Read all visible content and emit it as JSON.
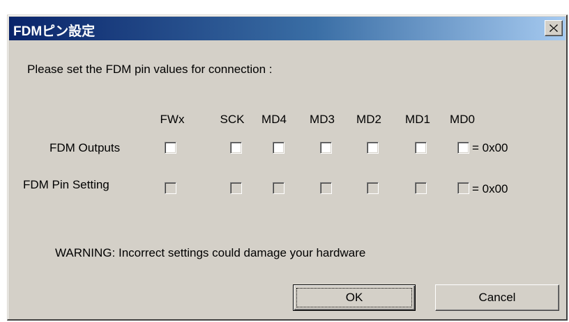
{
  "window": {
    "title": "FDMピン設定",
    "close_label": "close"
  },
  "prompt": "Please set the FDM pin values for connection :",
  "columns": [
    "FWx",
    "SCK",
    "MD4",
    "MD3",
    "MD2",
    "MD1",
    "MD0"
  ],
  "rows": {
    "outputs": {
      "label": "FDM Outputs",
      "checked": [
        false,
        false,
        false,
        false,
        false,
        false,
        false
      ],
      "enabled": true,
      "value": "= 0x00"
    },
    "pin_setting": {
      "label": "FDM Pin Setting",
      "checked": [
        false,
        false,
        false,
        false,
        false,
        false,
        false
      ],
      "enabled": false,
      "value": "= 0x00"
    }
  },
  "warning": "WARNING: Incorrect settings could damage your hardware",
  "buttons": {
    "ok": "OK",
    "cancel": "Cancel"
  },
  "colors": {
    "title_gradient_start": "#0a246a",
    "title_gradient_end": "#a6caf0",
    "face": "#d4d0c8"
  }
}
